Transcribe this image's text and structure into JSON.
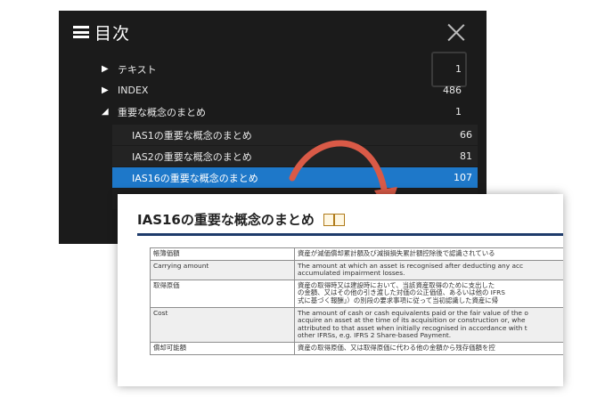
{
  "toc": {
    "title": "目次",
    "rows": [
      {
        "label": "テキスト",
        "page": "1"
      },
      {
        "label": "INDEX",
        "page": "486"
      },
      {
        "label": "重要な概念のまとめ",
        "page": "1"
      },
      {
        "label": "IAS1の重要な概念のまとめ",
        "page": "66"
      },
      {
        "label": "IAS2の重要な概念のまとめ",
        "page": "81"
      },
      {
        "label": "IAS16の重要な概念のまとめ",
        "page": "107"
      }
    ]
  },
  "doc": {
    "title": "IAS16の重要な概念のまとめ",
    "table": [
      {
        "term": "帳簿価額",
        "lines": [
          "資産が減価償却累計額及び減損損失累計額控除後で認識されている"
        ]
      },
      {
        "term": "Carrying amount",
        "lines": [
          "The amount at which an asset is recognised after deducting any acc",
          "accumulated impairment losses."
        ]
      },
      {
        "term": "取得原価",
        "lines": [
          "資産の取得時又は建設時において、当該資産取得のために支出した",
          "の金額、又はその他の引き渡した対価の公正価値、あるいは他の IFRS",
          "式に基づく報酬」）の別段の要求事項に従って当初認識した資産に帰"
        ]
      },
      {
        "term": "Cost",
        "lines": [
          "The amount of cash or cash equivalents paid or the fair value of the o",
          "acquire an asset at the time of its acquisition or construction or, whe",
          "attributed to that asset when initially recognised in accordance with t",
          "other IFRSs, e.g. IFRS 2 Share-based Payment."
        ]
      },
      {
        "term": "償却可能額",
        "lines": [
          "資産の取得原価、又は取得原価に代わる他の金額から残存価額を控"
        ]
      }
    ]
  },
  "colors": {
    "toc_bg": "#1b1b1b",
    "selected": "#1e78c9",
    "arrow": "#d95a47",
    "rule": "#1e3b6b"
  }
}
